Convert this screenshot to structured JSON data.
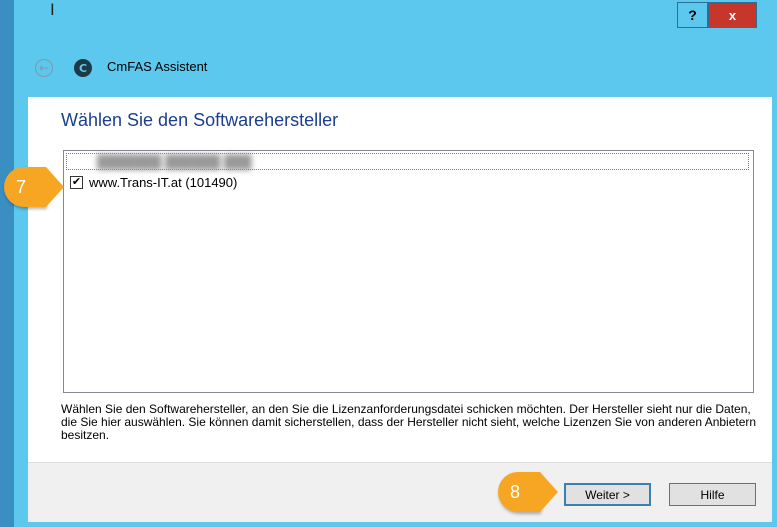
{
  "titlebar": {
    "cursor_glyph": "Ⅰ",
    "help_label": "?",
    "close_label": "x"
  },
  "nav": {
    "back_icon": "back-arrow-icon",
    "app_icon": "cmfas-logo-icon",
    "title": "CmFAS Assistent"
  },
  "main": {
    "heading": "Wählen Sie den Softwarehersteller",
    "list": [
      {
        "label": "",
        "checked": false,
        "blurred": true
      },
      {
        "label": "www.Trans-IT.at (101490)",
        "checked": true,
        "blurred": false
      }
    ],
    "description": "Wählen Sie den Softwarehersteller, an den Sie die Lizenzanforderungsdatei schicken möchten. Der Hersteller sieht nur die Daten, die Sie hier auswählen. Sie können damit sicherstellen, dass der Hersteller nicht sieht, welche Lizenzen Sie von anderen Anbietern besitzen."
  },
  "footer": {
    "next_label": "Weiter >",
    "help_label": "Hilfe"
  },
  "callouts": [
    {
      "label": "7",
      "color": "#f6a623"
    },
    {
      "label": "8",
      "color": "#f6a623"
    }
  ],
  "colors": {
    "window_bg": "#5cc8ee",
    "heading": "#1b3e8f",
    "close": "#c7362b"
  }
}
